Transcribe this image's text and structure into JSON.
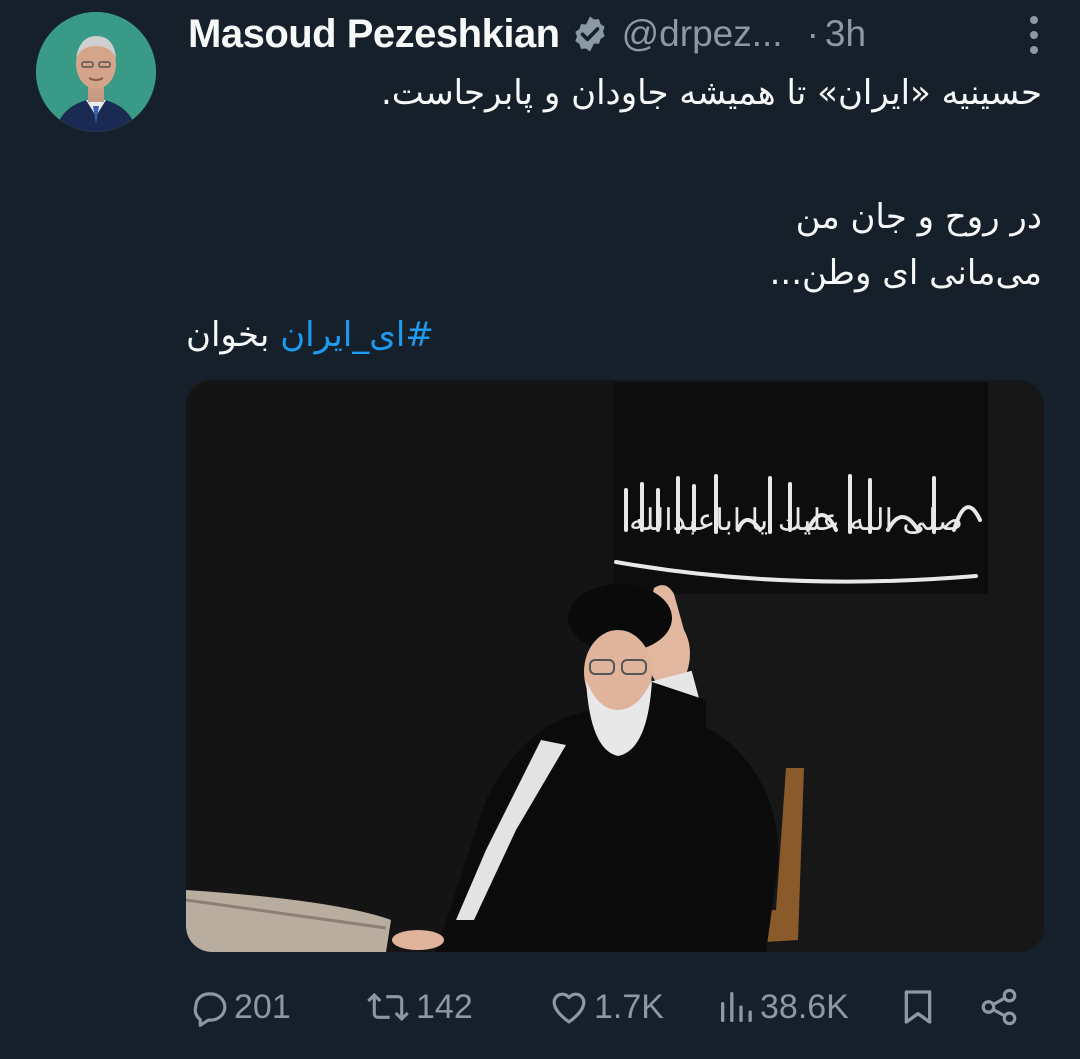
{
  "tweet": {
    "author_name": "Masoud Pezeshkian",
    "handle": "@drpez...",
    "separator": "·",
    "time": "3h",
    "text_lines": [
      "حسینیه «ایران» تا همیشه جاودان و پابرجاست.",
      "در روح و جان من",
      "می‌مانی ای وطن..."
    ],
    "hashtag": "#ای_ایران",
    "hashtag_tail": "بخوان",
    "media_caption_art": "صلى الله عليك يا اباعبدالله"
  },
  "actions": {
    "replies": "201",
    "retweets": "142",
    "likes": "1.7K",
    "views": "38.6K"
  },
  "icons": {
    "verified": "verified-badge-icon",
    "more": "more-vertical-icon",
    "reply": "reply-icon",
    "retweet": "retweet-icon",
    "like": "heart-icon",
    "views": "views-chart-icon",
    "bookmark": "bookmark-icon",
    "share": "share-icon"
  },
  "colors": {
    "background": "#15202b",
    "text": "#f7f9f9",
    "muted": "#8b98a5",
    "accent": "#1d9bf0"
  }
}
